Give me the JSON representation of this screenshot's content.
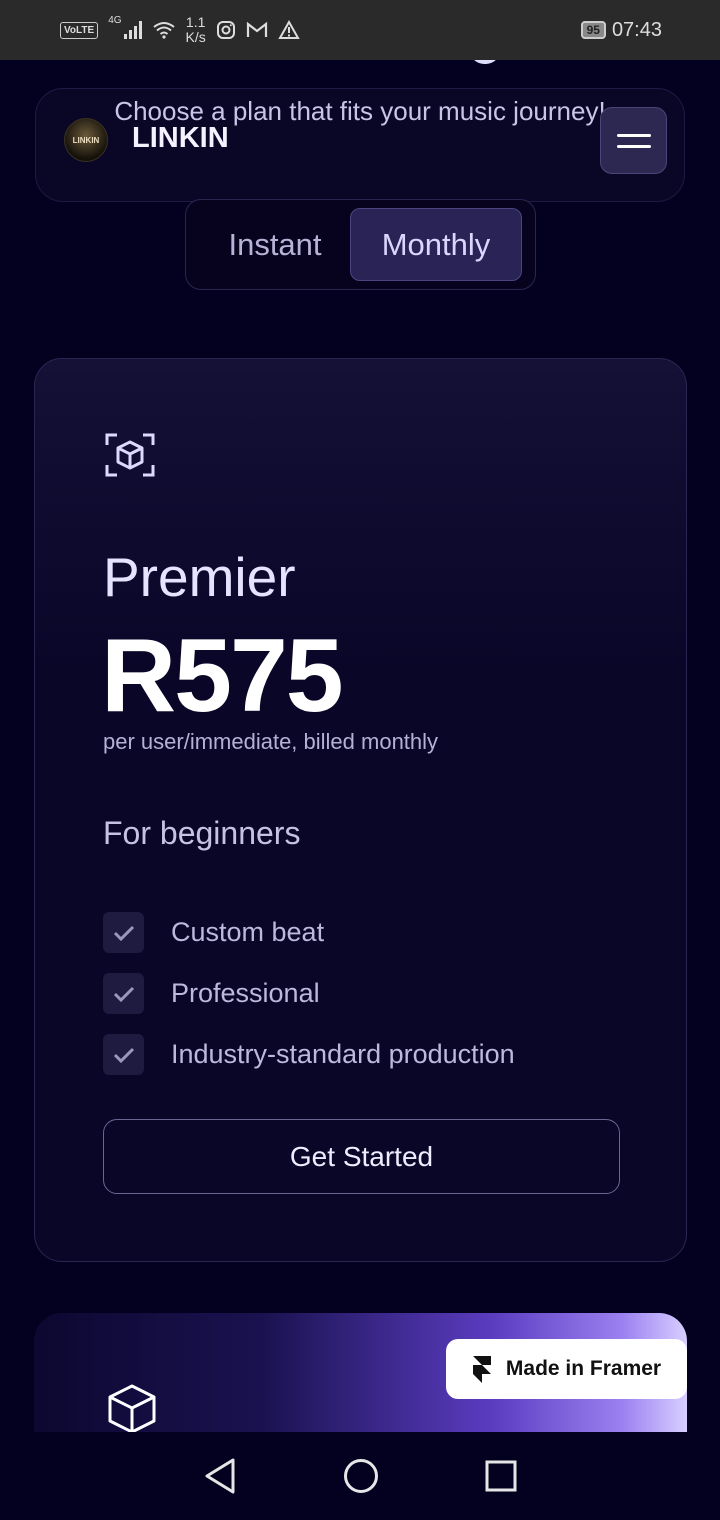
{
  "status_bar": {
    "network": "4G",
    "volte": "VoLTE",
    "speed": "1.1\nK/s",
    "speed_value": "1.1",
    "speed_unit": "K/s",
    "battery": "95",
    "time": "07:43",
    "icons": [
      "volte-icon",
      "signal-icon",
      "wifi-icon",
      "instagram-icon",
      "gmail-icon",
      "warning-icon"
    ]
  },
  "header": {
    "tagline": "Choose a plan that fits your music journey!",
    "logo_text": "LINKIN",
    "brand": "LINKIN",
    "menu_icon": "hamburger-icon"
  },
  "billing_toggle": {
    "options": [
      "Instant",
      "Monthly"
    ],
    "selected": "Monthly"
  },
  "plan": {
    "icon": "cube-scan-icon",
    "name": "Premier",
    "price": "R575",
    "billing": "per user/immediate, billed monthly",
    "audience": "For beginners",
    "features": [
      "Custom beat",
      "Professional",
      "Industry-standard production"
    ],
    "cta": "Get Started"
  },
  "next_plan": {
    "icon": "cube-icon"
  },
  "badge": {
    "label": "Made in Framer",
    "icon": "framer-icon"
  },
  "colors": {
    "background": "#04001f",
    "card": "#0a0628",
    "accent": "#2a2456",
    "gradient_end": "#9a80f0"
  },
  "system_nav": [
    "back-icon",
    "home-icon",
    "recents-icon"
  ]
}
